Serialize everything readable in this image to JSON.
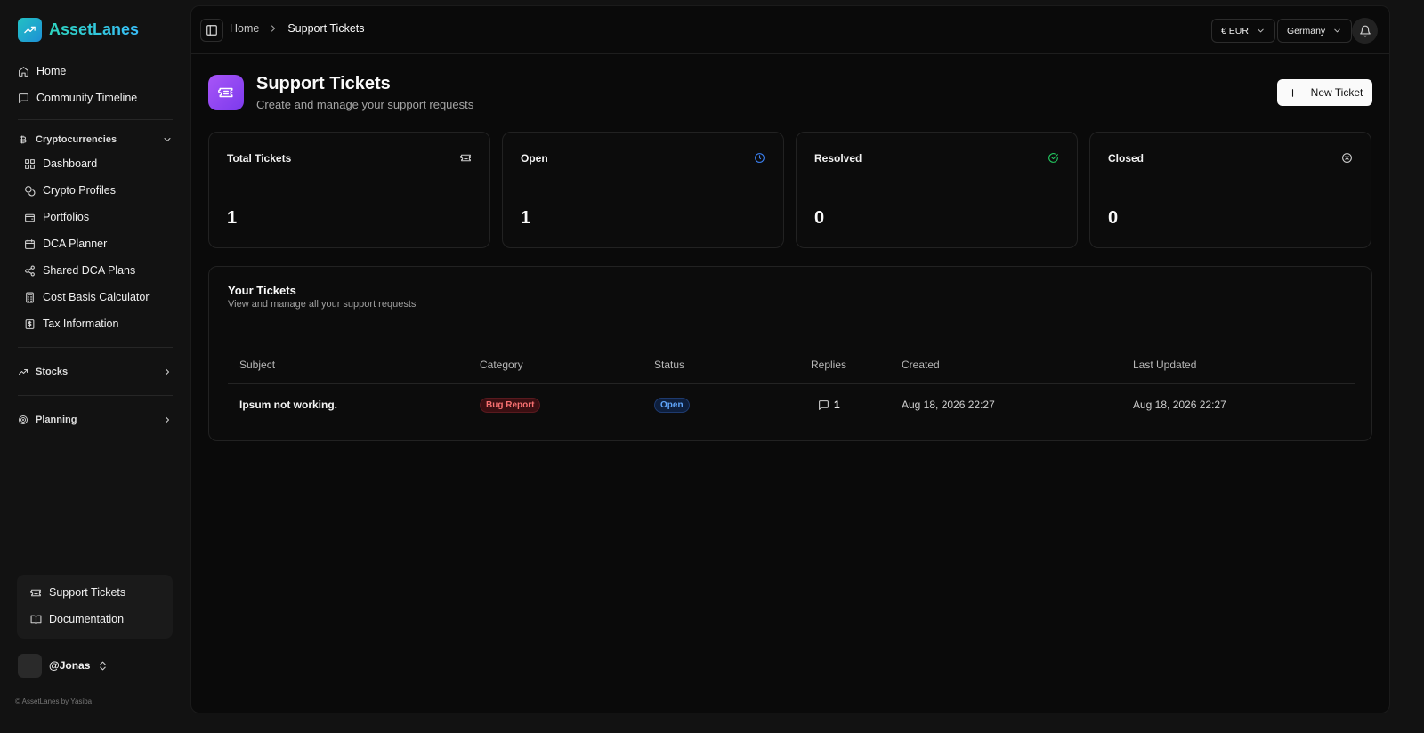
{
  "app": {
    "name": "AssetLanes",
    "footer": "© AssetLanes by Yasiba"
  },
  "sidebar": {
    "top_items": [
      {
        "label": "Home",
        "icon": "home-icon"
      },
      {
        "label": "Community Timeline",
        "icon": "message-square-icon"
      }
    ],
    "crypto": {
      "label": "Cryptocurrencies",
      "items": [
        {
          "label": "Dashboard",
          "icon": "grid-icon"
        },
        {
          "label": "Crypto Profiles",
          "icon": "coins-icon"
        },
        {
          "label": "Portfolios",
          "icon": "wallet-icon"
        },
        {
          "label": "DCA Planner",
          "icon": "calendar-icon"
        },
        {
          "label": "Shared DCA Plans",
          "icon": "share-icon"
        },
        {
          "label": "Cost Basis Calculator",
          "icon": "calculator-icon"
        },
        {
          "label": "Tax Information",
          "icon": "receipt-icon"
        }
      ]
    },
    "stocks": {
      "label": "Stocks"
    },
    "planning": {
      "label": "Planning"
    },
    "bottom_items": [
      {
        "label": "Support Tickets",
        "icon": "ticket-icon"
      },
      {
        "label": "Documentation",
        "icon": "book-icon"
      }
    ],
    "user": {
      "name": "@Jonas"
    }
  },
  "topbar": {
    "breadcrumb": {
      "home": "Home",
      "current": "Support Tickets"
    },
    "currency": "€ EUR",
    "country": "Germany"
  },
  "page": {
    "title": "Support Tickets",
    "subtitle": "Create and manage your support requests",
    "new_button": "New Ticket"
  },
  "stats": [
    {
      "label": "Total Tickets",
      "value": "1",
      "icon": "ticket-icon",
      "color": "#cfcfcf"
    },
    {
      "label": "Open",
      "value": "1",
      "icon": "clock-icon",
      "color": "#3b82f6"
    },
    {
      "label": "Resolved",
      "value": "0",
      "icon": "check-circle-icon",
      "color": "#22c55e"
    },
    {
      "label": "Closed",
      "value": "0",
      "icon": "x-circle-icon",
      "color": "#cfcfcf"
    }
  ],
  "tickets": {
    "title": "Your Tickets",
    "subtitle": "View and manage all your support requests",
    "columns": [
      "Subject",
      "Category",
      "Status",
      "Replies",
      "Created",
      "Last Updated"
    ],
    "rows": [
      {
        "subject": "Ipsum not working.",
        "category": "Bug Report",
        "status": "Open",
        "replies": "1",
        "created": "Aug 18, 2026 22:27",
        "updated": "Aug 18, 2026 22:27"
      }
    ]
  }
}
